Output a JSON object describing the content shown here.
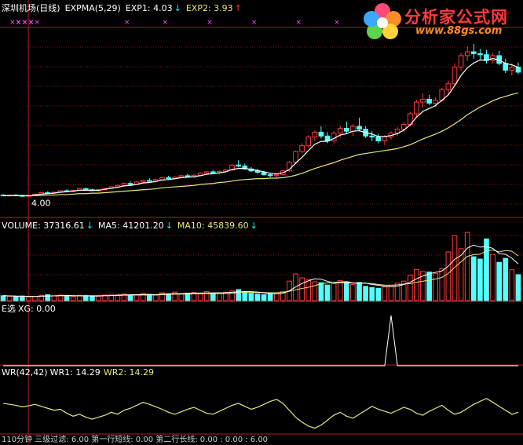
{
  "main": {
    "title": "深圳机场(日线)",
    "indicator": "EXPMA(5,29)",
    "exp1_label": "EXP1: 4.03",
    "exp2_label": "EXP2: 3.93",
    "price_label": "4.00",
    "arrow_down": "↓",
    "arrow_up": "↑"
  },
  "volume": {
    "label": "VOLUME: 37316.61",
    "ma5_label": "MA5: 41201.20",
    "ma10_label": "MA10: 45839.60"
  },
  "signal": {
    "label": "E选",
    "xg_label": "XG: 0.00"
  },
  "wr": {
    "label": "WR(42,42)",
    "wr1_label": "WR1: 14.29",
    "wr2_label": "WR2: 14.29"
  },
  "bottom": {
    "text": "110分钟 三级过滤: 6.00  第一行短线: 0.00  第二行长线: 0.00  : 0.00  : 6.00"
  },
  "logo": {
    "main": "分析家公式网",
    "url": "www.88gs.com"
  },
  "colors": {
    "up": "#ff3a3a",
    "down": "#54ffff",
    "exp1": "#ffffff",
    "exp2": "#e8e87a",
    "grid": "#8a0f0f",
    "wr": "#e8e87a",
    "signal": "#ffffff"
  },
  "chart_data": [
    {
      "type": "candlestick",
      "title": "深圳机场(日线)",
      "ylim": [
        3.6,
        7.2
      ],
      "candles": [
        [
          3.98,
          4.0,
          3.96,
          3.97
        ],
        [
          3.97,
          3.99,
          3.95,
          3.98
        ],
        [
          3.98,
          4.0,
          3.96,
          3.97
        ],
        [
          3.97,
          3.99,
          3.95,
          3.96
        ],
        [
          3.96,
          3.98,
          3.94,
          3.97
        ],
        [
          3.97,
          4.01,
          3.96,
          4.0
        ],
        [
          4.0,
          4.04,
          3.99,
          4.03
        ],
        [
          4.03,
          4.06,
          4.01,
          4.02
        ],
        [
          4.02,
          4.05,
          4.0,
          4.04
        ],
        [
          4.04,
          4.08,
          4.03,
          4.07
        ],
        [
          4.07,
          4.1,
          4.05,
          4.06
        ],
        [
          4.06,
          4.09,
          4.04,
          4.08
        ],
        [
          4.08,
          4.12,
          4.07,
          4.11
        ],
        [
          4.11,
          4.14,
          4.08,
          4.09
        ],
        [
          4.09,
          4.11,
          4.06,
          4.07
        ],
        [
          4.07,
          4.1,
          4.05,
          4.09
        ],
        [
          4.09,
          4.13,
          4.08,
          4.12
        ],
        [
          4.12,
          4.16,
          4.1,
          4.15
        ],
        [
          4.15,
          4.2,
          4.13,
          4.18
        ],
        [
          4.18,
          4.24,
          4.16,
          4.22
        ],
        [
          4.22,
          4.26,
          4.18,
          4.2
        ],
        [
          4.2,
          4.27,
          4.19,
          4.25
        ],
        [
          4.25,
          4.3,
          4.23,
          4.28
        ],
        [
          4.28,
          4.33,
          4.25,
          4.27
        ],
        [
          4.27,
          4.31,
          4.24,
          4.3
        ],
        [
          4.3,
          4.36,
          4.28,
          4.34
        ],
        [
          4.34,
          4.38,
          4.3,
          4.32
        ],
        [
          4.32,
          4.37,
          4.3,
          4.35
        ],
        [
          4.35,
          4.4,
          4.33,
          4.38
        ],
        [
          4.38,
          4.42,
          4.34,
          4.36
        ],
        [
          4.36,
          4.41,
          4.33,
          4.39
        ],
        [
          4.39,
          4.45,
          4.37,
          4.43
        ],
        [
          4.43,
          4.48,
          4.4,
          4.46
        ],
        [
          4.46,
          4.5,
          4.42,
          4.44
        ],
        [
          4.44,
          4.49,
          4.41,
          4.47
        ],
        [
          4.47,
          4.52,
          4.44,
          4.5
        ],
        [
          4.5,
          4.62,
          4.48,
          4.6
        ],
        [
          4.6,
          4.7,
          4.55,
          4.58
        ],
        [
          4.58,
          4.63,
          4.5,
          4.52
        ],
        [
          4.52,
          4.56,
          4.45,
          4.48
        ],
        [
          4.48,
          4.52,
          4.42,
          4.45
        ],
        [
          4.45,
          4.48,
          4.38,
          4.4
        ],
        [
          4.4,
          4.44,
          4.35,
          4.38
        ],
        [
          4.38,
          4.42,
          4.34,
          4.4
        ],
        [
          4.4,
          4.5,
          4.38,
          4.48
        ],
        [
          4.48,
          4.68,
          4.46,
          4.66
        ],
        [
          4.66,
          4.9,
          4.62,
          4.88
        ],
        [
          4.88,
          5.05,
          4.84,
          5.0
        ],
        [
          5.0,
          5.22,
          4.96,
          5.18
        ],
        [
          5.18,
          5.32,
          5.1,
          5.28
        ],
        [
          5.28,
          5.4,
          5.15,
          5.2
        ],
        [
          5.2,
          5.28,
          5.05,
          5.1
        ],
        [
          5.1,
          5.3,
          5.05,
          5.26
        ],
        [
          5.26,
          5.42,
          5.18,
          5.36
        ],
        [
          5.36,
          5.5,
          5.24,
          5.3
        ],
        [
          5.3,
          5.45,
          5.2,
          5.4
        ],
        [
          5.4,
          5.58,
          5.3,
          5.34
        ],
        [
          5.34,
          5.4,
          5.16,
          5.2
        ],
        [
          5.2,
          5.3,
          5.1,
          5.18
        ],
        [
          5.18,
          5.25,
          5.05,
          5.1
        ],
        [
          5.1,
          5.22,
          5.02,
          5.18
        ],
        [
          5.18,
          5.3,
          5.12,
          5.26
        ],
        [
          5.26,
          5.38,
          5.2,
          5.34
        ],
        [
          5.34,
          5.48,
          5.28,
          5.44
        ],
        [
          5.44,
          5.7,
          5.4,
          5.66
        ],
        [
          5.66,
          5.95,
          5.6,
          5.9
        ],
        [
          5.9,
          6.08,
          5.8,
          5.96
        ],
        [
          5.96,
          6.05,
          5.84,
          5.88
        ],
        [
          5.88,
          6.0,
          5.8,
          5.94
        ],
        [
          5.94,
          6.2,
          5.9,
          6.16
        ],
        [
          6.16,
          6.35,
          6.05,
          6.28
        ],
        [
          6.28,
          6.7,
          6.22,
          6.62
        ],
        [
          6.62,
          6.92,
          6.55,
          6.86
        ],
        [
          6.86,
          7.05,
          6.75,
          6.94
        ],
        [
          6.94,
          7.1,
          6.8,
          6.9
        ],
        [
          6.9,
          7.0,
          6.78,
          6.88
        ],
        [
          6.88,
          6.98,
          6.7,
          6.76
        ],
        [
          6.76,
          6.92,
          6.7,
          6.86
        ],
        [
          6.86,
          6.96,
          6.66,
          6.7
        ],
        [
          6.7,
          6.8,
          6.5,
          6.56
        ],
        [
          6.56,
          6.7,
          6.46,
          6.62
        ],
        [
          6.62,
          6.72,
          6.48,
          6.52
        ]
      ],
      "exp1": [
        3.97,
        3.97,
        3.97,
        3.97,
        3.97,
        3.98,
        4.0,
        4.01,
        4.02,
        4.04,
        4.05,
        4.06,
        4.08,
        4.08,
        4.08,
        4.08,
        4.1,
        4.12,
        4.14,
        4.17,
        4.18,
        4.2,
        4.23,
        4.24,
        4.26,
        4.29,
        4.3,
        4.32,
        4.34,
        4.35,
        4.36,
        4.38,
        4.41,
        4.42,
        4.44,
        4.46,
        4.51,
        4.53,
        4.53,
        4.51,
        4.49,
        4.46,
        4.43,
        4.42,
        4.44,
        4.51,
        4.64,
        4.76,
        4.9,
        5.03,
        5.09,
        5.09,
        5.15,
        5.22,
        5.25,
        5.3,
        5.31,
        5.27,
        5.24,
        5.19,
        5.19,
        5.21,
        5.25,
        5.32,
        5.43,
        5.59,
        5.71,
        5.77,
        5.83,
        5.94,
        6.05,
        6.24,
        6.45,
        6.61,
        6.71,
        6.77,
        6.77,
        6.8,
        6.77,
        6.7,
        6.67,
        6.62
      ],
      "exp2": [
        3.97,
        3.97,
        3.97,
        3.97,
        3.97,
        3.97,
        3.97,
        3.98,
        3.98,
        3.99,
        3.99,
        4.0,
        4.01,
        4.01,
        4.02,
        4.02,
        4.03,
        4.04,
        4.05,
        4.06,
        4.07,
        4.08,
        4.09,
        4.1,
        4.11,
        4.13,
        4.14,
        4.15,
        4.16,
        4.17,
        4.18,
        4.2,
        4.21,
        4.22,
        4.24,
        4.25,
        4.27,
        4.29,
        4.3,
        4.31,
        4.32,
        4.32,
        4.33,
        4.33,
        4.34,
        4.36,
        4.39,
        4.43,
        4.48,
        4.53,
        4.57,
        4.61,
        4.65,
        4.7,
        4.74,
        4.78,
        4.82,
        4.84,
        4.86,
        4.88,
        4.9,
        4.92,
        4.94,
        4.98,
        5.02,
        5.08,
        5.14,
        5.19,
        5.24,
        5.3,
        5.37,
        5.45,
        5.54,
        5.64,
        5.72,
        5.8,
        5.86,
        5.93,
        5.98,
        6.02,
        6.06,
        6.09
      ]
    },
    {
      "type": "bar",
      "title": "VOLUME",
      "ylim": [
        0,
        220000
      ],
      "values": [
        15000,
        13000,
        12000,
        14000,
        11000,
        13000,
        16000,
        18000,
        15000,
        17000,
        14000,
        12000,
        16000,
        15000,
        13000,
        14000,
        17000,
        19000,
        18000,
        20000,
        16000,
        18000,
        22000,
        19000,
        17000,
        24000,
        21000,
        26000,
        20000,
        23000,
        25000,
        22000,
        28000,
        21000,
        24000,
        26000,
        30000,
        34000,
        25000,
        22000,
        20000,
        18000,
        21000,
        24000,
        28000,
        60000,
        82000,
        70000,
        65000,
        58000,
        55000,
        48000,
        52000,
        62000,
        58000,
        50000,
        56000,
        44000,
        40000,
        38000,
        42000,
        48000,
        54000,
        60000,
        78000,
        96000,
        90000,
        88000,
        84000,
        98000,
        150000,
        200000,
        160000,
        210000,
        135000,
        128000,
        190000,
        142000,
        118000,
        130000,
        95000,
        80000
      ],
      "ma5": [
        15000,
        14500,
        13800,
        13700,
        13000,
        12600,
        13600,
        14400,
        14600,
        15800,
        16000,
        15200,
        14800,
        14800,
        14000,
        14000,
        15000,
        15600,
        16200,
        17600,
        18000,
        18200,
        18800,
        19000,
        18400,
        20000,
        20600,
        21600,
        21600,
        22800,
        23000,
        23200,
        23600,
        24000,
        24000,
        24200,
        25800,
        27000,
        27800,
        27400,
        26200,
        24000,
        21600,
        21000,
        22200,
        30200,
        42200,
        52600,
        61000,
        67000,
        66000,
        59200,
        54600,
        55000,
        55200,
        54000,
        53600,
        54000,
        49600,
        47200,
        44000,
        42400,
        44400,
        49600,
        56400,
        67200,
        75600,
        82400,
        87200,
        91200,
        106000,
        127200,
        139200,
        161600,
        171000,
        164600,
        166600,
        161000,
        144600,
        142600,
        130600,
        113000
      ],
      "ma10": [
        15000,
        14500,
        13800,
        13700,
        13200,
        13000,
        13500,
        14000,
        14500,
        14900,
        15100,
        14800,
        14600,
        15100,
        15000,
        15000,
        15200,
        15400,
        15500,
        16700,
        17000,
        16900,
        17100,
        17400,
        17200,
        18200,
        18900,
        19600,
        19800,
        20600,
        21000,
        21300,
        21600,
        22100,
        21800,
        22200,
        23000,
        24400,
        24700,
        24700,
        25100,
        24700,
        24300,
        24500,
        25200,
        28800,
        33400,
        37300,
        41100,
        46000,
        51700,
        54400,
        56000,
        57400,
        58500,
        54500,
        53400,
        53600,
        52600,
        49500,
        47800,
        46800,
        48600,
        51100,
        52200,
        56400,
        59700,
        62500,
        66600,
        71500,
        83400,
        102400,
        119500,
        136300,
        141600,
        142900,
        153100,
        155800,
        150000,
        154100,
        152000,
        137500
      ]
    },
    {
      "type": "line",
      "title": "E选",
      "ylim": [
        0,
        1
      ],
      "values": [
        0,
        0,
        0,
        0,
        0,
        0,
        0,
        0,
        0,
        0,
        0,
        0,
        0,
        0,
        0,
        0,
        0,
        0,
        0,
        0,
        0,
        0,
        0,
        0,
        0,
        0,
        0,
        0,
        0,
        0,
        0,
        0,
        0,
        0,
        0,
        0,
        0,
        0,
        0,
        0,
        0,
        0,
        0,
        0,
        0,
        0,
        0,
        0,
        0,
        0,
        0,
        0,
        0,
        0,
        0,
        0,
        0,
        0,
        0,
        0,
        0,
        1,
        0,
        0,
        0,
        0,
        0,
        0,
        0,
        0,
        0,
        0,
        0,
        0,
        0,
        0,
        0,
        0,
        0,
        0,
        0,
        0
      ]
    },
    {
      "type": "line",
      "title": "WR(42,42)",
      "ylim": [
        0,
        100
      ],
      "values": [
        62,
        60,
        58,
        55,
        57,
        60,
        56,
        52,
        48,
        50,
        42,
        36,
        40,
        34,
        30,
        34,
        38,
        44,
        40,
        48,
        52,
        58,
        64,
        60,
        55,
        50,
        44,
        40,
        45,
        50,
        54,
        48,
        42,
        40,
        46,
        52,
        58,
        62,
        56,
        50,
        54,
        60,
        66,
        70,
        62,
        48,
        34,
        24,
        16,
        12,
        18,
        28,
        38,
        44,
        36,
        32,
        40,
        48,
        56,
        50,
        46,
        42,
        48,
        54,
        50,
        42,
        38,
        46,
        52,
        58,
        48,
        40,
        44,
        52,
        60,
        66,
        72,
        64,
        56,
        48,
        40,
        44
      ]
    }
  ]
}
